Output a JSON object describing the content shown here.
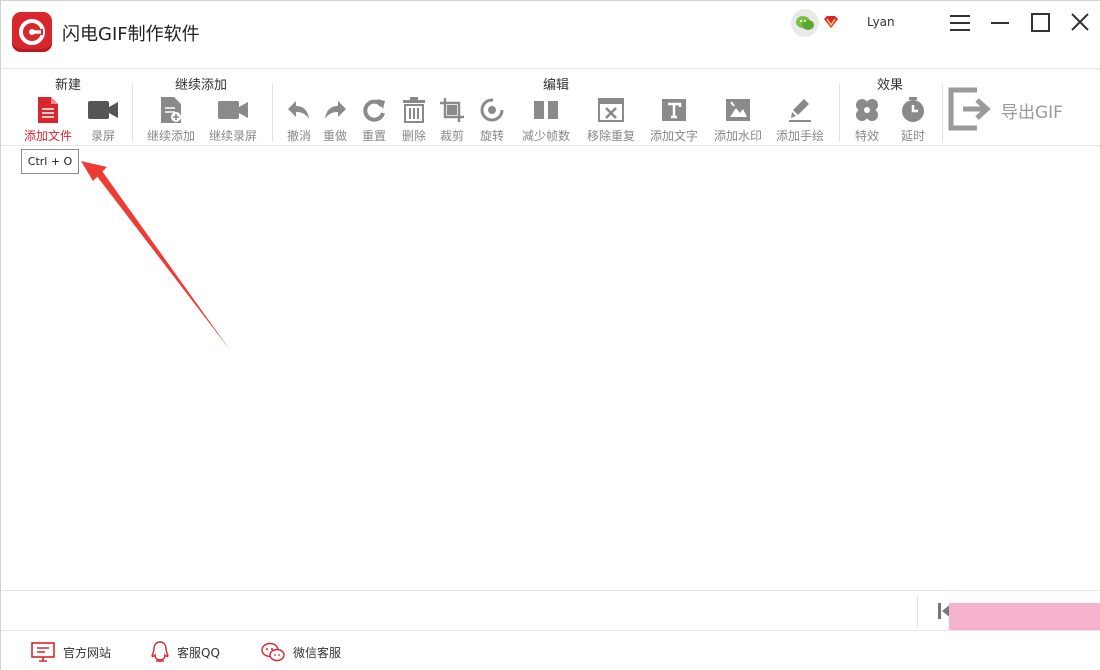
{
  "app": {
    "title": "闪电GIF制作软件"
  },
  "user": {
    "name": "Lyan"
  },
  "toolbar": {
    "groups": {
      "new": "新建",
      "continue_add": "继续添加",
      "edit": "编辑",
      "effects": "效果"
    },
    "tools": {
      "add_file": "添加文件",
      "record_screen": "录屏",
      "continue_add": "继续添加",
      "continue_record": "继续录屏",
      "undo": "撤消",
      "redo": "重做",
      "reset": "重置",
      "delete": "删除",
      "crop": "裁剪",
      "rotate": "旋转",
      "reduce_frames": "减少帧数",
      "remove_duplicates": "移除重复",
      "add_text": "添加文字",
      "add_watermark": "添加水印",
      "add_drawing": "添加手绘",
      "special_effects": "特效",
      "delay": "延时"
    },
    "export": "导出GIF"
  },
  "tooltip": {
    "text": "Ctrl + O"
  },
  "footer": {
    "website": "官方网站",
    "qq_support": "客服QQ",
    "wechat_support": "微信客服"
  },
  "colors": {
    "accent": "#d9262c",
    "icon_gray": "#8a8a8a",
    "annotation_arrow": "#ee3b33"
  }
}
